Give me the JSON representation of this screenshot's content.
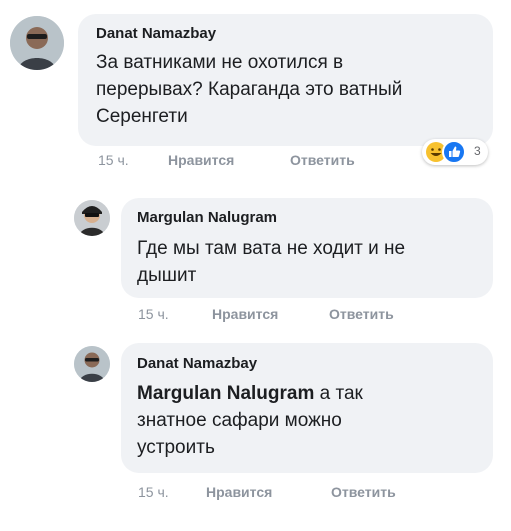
{
  "comments": [
    {
      "author": "Danat Namazbay",
      "lines": [
        "За ватниками не охотился в",
        "перерывах? Караганда это ватный",
        "Серенгети"
      ],
      "time": "15 ч.",
      "like_label": "Нравится",
      "reply_label": "Ответить",
      "reactions": {
        "icons": [
          "laugh-emoji-icon",
          "like-thumb-icon"
        ],
        "count": "3"
      }
    },
    {
      "author": "Margulan Nalugram",
      "lines": [
        "Где мы там вата не ходит и не",
        "дышит"
      ],
      "time": "15 ч.",
      "like_label": "Нравится",
      "reply_label": "Ответить"
    },
    {
      "author": "Danat Namazbay",
      "mention": "Margulan Nalugram",
      "lines_after_mention": " а так",
      "lines": [
        "знатное сафари можно",
        "устроить"
      ],
      "time": "15 ч.",
      "like_label": "Нравится",
      "reply_label": "Ответить"
    }
  ],
  "colors": {
    "bubble": "#f0f2f5",
    "meta_text": "#8d949e",
    "like_blue": "#1877f2",
    "laugh_yellow": "#f7c12e"
  }
}
